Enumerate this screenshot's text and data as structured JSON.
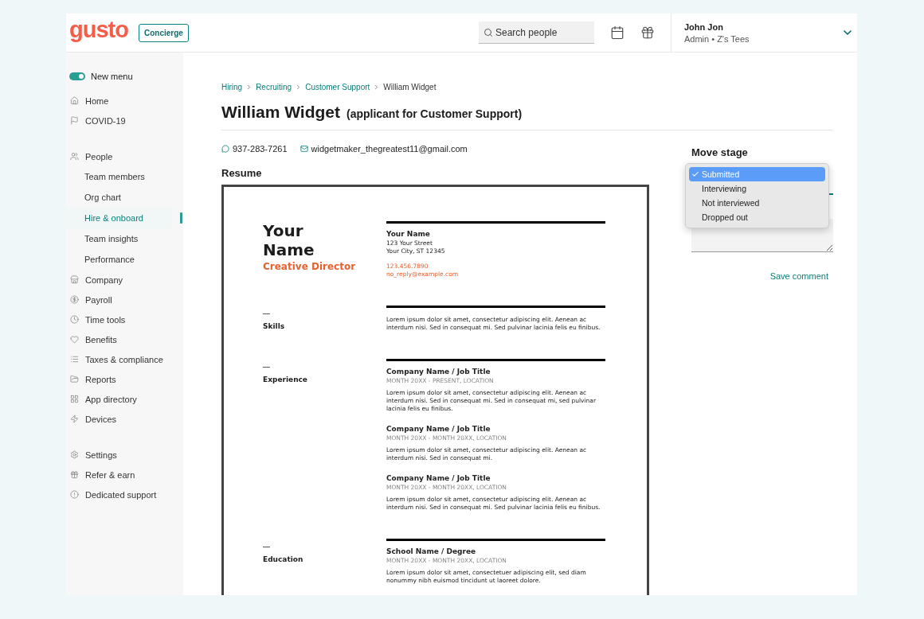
{
  "header": {
    "logo": "gusto",
    "concierge": "Concierge",
    "search": {
      "placeholder": "Search people"
    },
    "user": {
      "name": "John Jon",
      "subtitle": "Admin • Z's Tees"
    }
  },
  "sidebar": {
    "toggle": {
      "label": "New menu",
      "on": true
    },
    "groups": [
      [
        {
          "label": "Home",
          "kind": "item",
          "selected": false
        },
        {
          "label": "COVID-19",
          "kind": "item",
          "selected": false
        }
      ],
      [
        {
          "label": "People",
          "kind": "item",
          "selected": false
        },
        {
          "label": "Team members",
          "kind": "sub",
          "selected": false
        },
        {
          "label": "Org chart",
          "kind": "sub",
          "selected": false
        },
        {
          "label": "Hire & onboard",
          "kind": "sub",
          "selected": true
        },
        {
          "label": "Team insights",
          "kind": "sub",
          "selected": false
        },
        {
          "label": "Performance",
          "kind": "sub",
          "selected": false
        },
        {
          "label": "Company",
          "kind": "item",
          "selected": false
        },
        {
          "label": "Payroll",
          "kind": "item",
          "selected": false
        },
        {
          "label": "Time tools",
          "kind": "item",
          "selected": false
        },
        {
          "label": "Benefits",
          "kind": "item",
          "selected": false
        },
        {
          "label": "Taxes & compliance",
          "kind": "item",
          "selected": false
        },
        {
          "label": "Reports",
          "kind": "item",
          "selected": false
        },
        {
          "label": "App directory",
          "kind": "item",
          "selected": false
        },
        {
          "label": "Devices",
          "kind": "item",
          "selected": false
        }
      ],
      [
        {
          "label": "Settings",
          "kind": "item",
          "selected": false
        },
        {
          "label": "Refer & earn",
          "kind": "item",
          "selected": false
        },
        {
          "label": "Dedicated support",
          "kind": "item",
          "selected": false
        }
      ]
    ]
  },
  "breadcrumb": [
    {
      "label": "Hiring",
      "link": true
    },
    {
      "label": "Recruiting",
      "link": true
    },
    {
      "label": "Customer Support",
      "link": true
    },
    {
      "label": "William Widget",
      "link": false
    }
  ],
  "title": "William Widget",
  "subtitle": "(applicant for Customer Support)",
  "contact": {
    "phone": "937-283-7261",
    "email": "widgetmaker_thegreatest11@gmail.com"
  },
  "resume_label": "Resume",
  "resume": {
    "name_lines": [
      "Your",
      "Name"
    ],
    "role": "Creative Director",
    "contact": {
      "name": "Your Name",
      "address": [
        "123 Your Street",
        "Your City, ST 12345"
      ],
      "phone": "123.456.7890",
      "email": "no_reply@example.com"
    },
    "sections": [
      {
        "heading": "Skills",
        "entries": [
          {
            "body": "Lorem ipsum dolor sit amet, consectetur adipiscing elit. Aenean ac interdum nisi. Sed in consequat mi. Sed pulvinar lacinia felis eu finibus."
          }
        ]
      },
      {
        "heading": "Experience",
        "entries": [
          {
            "title": "**Company Name** / Job Title",
            "dates": "MONTH 20XX - PRESENT, LOCATION",
            "body": "Lorem ipsum dolor sit amet, consectetur adipiscing elit. Aenean ac interdum nisi. Sed in consequat mi. Sed in consequat mi, sed pulvinar lacinia felis eu finibus."
          },
          {
            "title": "**Company Name** / Job Title",
            "dates": "MONTH 20XX - MONTH 20XX, LOCATION",
            "body": "Lorem ipsum dolor sit amet, consectetur adipiscing elit. Aenean ac interdum nisi. Sed in consequat mi."
          },
          {
            "title": "**Company Name** / Job Title",
            "dates": "MONTH 20XX - MONTH 20XX, LOCATION",
            "body": "Lorem ipsum dolor sit amet, consectetur adipiscing elit. Aenean ac interdum nisi. Sed in consequat mi. Sed pulvinar lacinia felis eu finibus."
          }
        ]
      },
      {
        "heading": "Education",
        "entries": [
          {
            "title": "**School Name** / Degree",
            "dates": "MONTH 20XX - MONTH 20XX, LOCATION",
            "body": "Lorem ipsum dolor sit amet, consectetuer adipiscing elit, sed diam nonummy nibh euismod tincidunt ut laoreet dolore."
          }
        ]
      }
    ]
  },
  "move_stage": {
    "label": "Move stage",
    "options": [
      {
        "label": "Submitted",
        "selected": true
      },
      {
        "label": "Interviewing",
        "selected": false
      },
      {
        "label": "Not interviewed",
        "selected": false
      },
      {
        "label": "Dropped out",
        "selected": false
      }
    ]
  },
  "save_comment": "Save comment"
}
